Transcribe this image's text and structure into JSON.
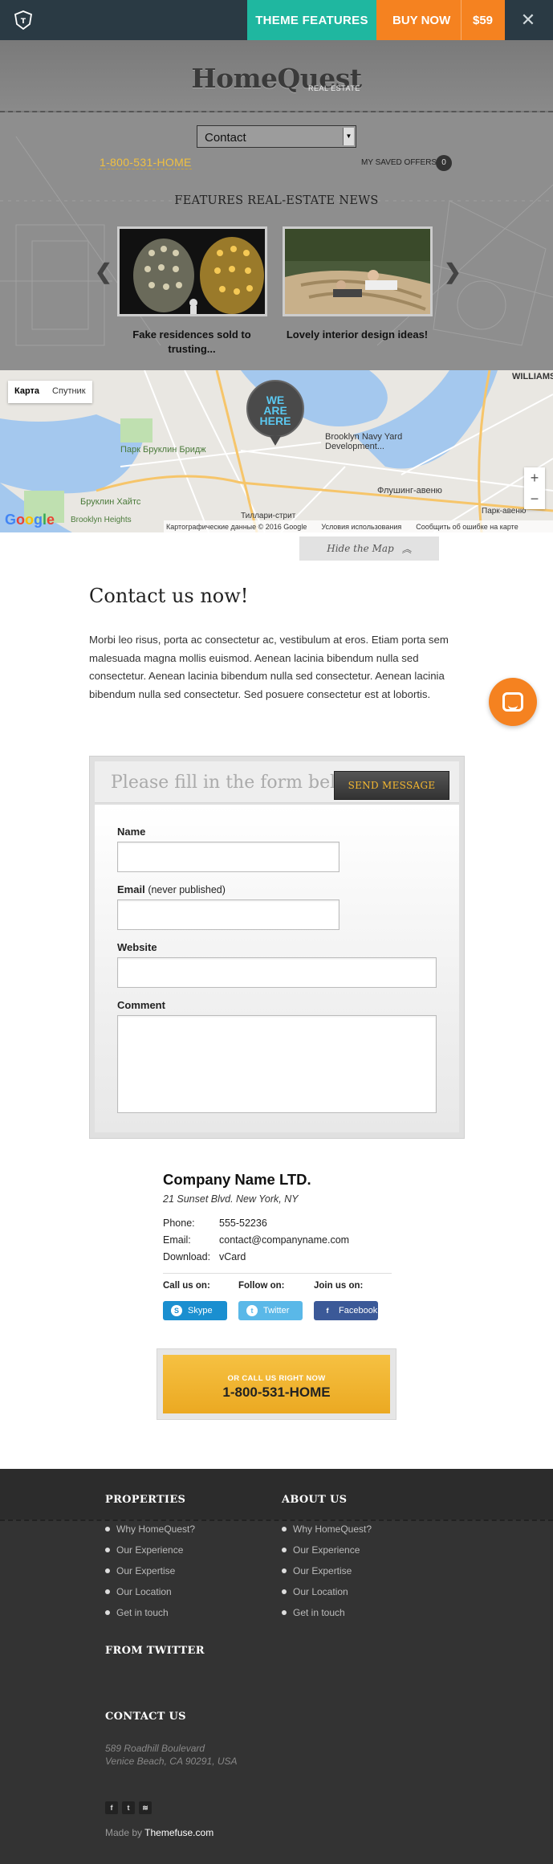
{
  "topbar": {
    "features_label": "THEME FEATURES",
    "buy_label": "BUY NOW",
    "price": "$59",
    "close_icon": "close-icon"
  },
  "header": {
    "brand": "HomeQuest",
    "brand_sub": "REAL ESTATE",
    "select_value": "Contact",
    "phone": "1-800-531-HOME",
    "saved_label": "MY SAVED OFFERS",
    "saved_count": "0"
  },
  "news": {
    "title": "FEATURES REAL-ESTATE NEWS",
    "items": [
      {
        "caption": "Fake residences sold to trusting..."
      },
      {
        "caption": "Lovely interior design ideas!"
      }
    ]
  },
  "map": {
    "tab_map": "Карта",
    "tab_satellite": "Спутник",
    "pin_line1": "WE",
    "pin_line2": "ARE",
    "pin_line3": "HERE",
    "labels": [
      "WILLIAMSBU",
      "Бруклин Хайтс",
      "Парк Бруклин Бридж",
      "Brooklyn Navy Yard Development...",
      "Флушинг-авеню",
      "Brooklyn Heights",
      "Тиллари-стрит",
      "Парк-авеню"
    ],
    "footer": [
      "Картографические данные © 2016 Google",
      "Условия использования",
      "Сообщить об ошибке на карте"
    ],
    "hide_label": "Hide the Map"
  },
  "contact": {
    "title": "Contact us now!",
    "text": "Morbi leo risus, porta ac consectetur ac, vestibulum at eros. Etiam porta sem malesuada magna mollis euismod. Aenean lacinia bibendum nulla sed consectetur. Aenean lacinia bibendum nulla sed consectetur. Aenean lacinia bibendum nulla sed consectetur. Sed posuere consectetur est at lobortis."
  },
  "form": {
    "placeholder": "Please fill in the form below",
    "send_label": "SEND MESSAGE",
    "name_label": "Name",
    "email_label": "Email",
    "email_note": "(never published)",
    "website_label": "Website",
    "comment_label": "Comment"
  },
  "company": {
    "name": "Company Name LTD.",
    "address": "21 Sunset Blvd. New York, NY",
    "phone_k": "Phone:",
    "phone_v": "555-52236",
    "email_k": "Email:",
    "email_v": "contact@companyname.com",
    "download_k": "Download:",
    "download_v": "vCard",
    "call_us": "Call us on:",
    "follow_us": "Follow on:",
    "join_us": "Join us on:",
    "skype": "Skype",
    "twitter": "Twitter",
    "facebook": "Facebook"
  },
  "callbox": {
    "sub": "OR CALL US RIGHT NOW",
    "phone": "1-800-531-HOME"
  },
  "footer": {
    "properties_title": "PROPERTIES",
    "about_title": "ABOUT US",
    "properties": [
      "Why HomeQuest?",
      "Our Experience",
      "Our Expertise",
      "Our Location",
      "Get in touch"
    ],
    "about": [
      "Why HomeQuest?",
      "Our Experience",
      "Our Expertise",
      "Our Location",
      "Get in touch"
    ],
    "twitter_title": "FROM TWITTER",
    "contact_title": "CONTACT US",
    "address_line1": "589 Roadhill Boulevard",
    "address_line2": "Venice Beach, CA 90291, USA",
    "made_by_prefix": "Made by",
    "made_by_name": "Themefuse.com"
  },
  "colors": {
    "teal": "#1fb7a0",
    "orange": "#f58220",
    "gold": "#f0c040",
    "footer_bg": "#333333"
  }
}
